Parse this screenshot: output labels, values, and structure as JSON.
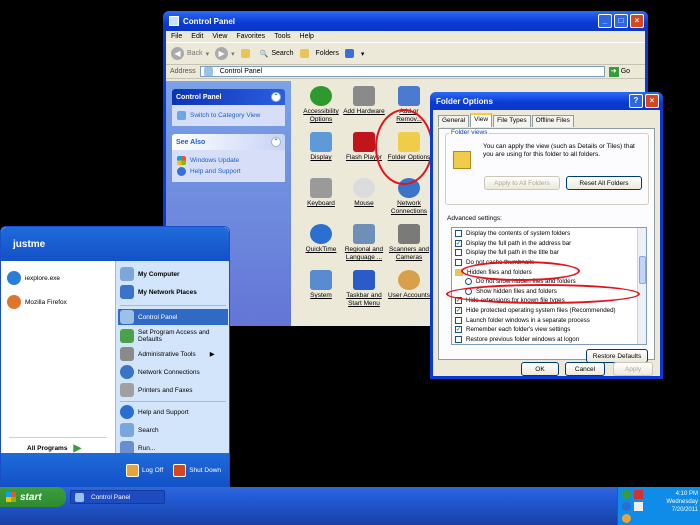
{
  "control_panel": {
    "title": "Control Panel",
    "menu": [
      "File",
      "Edit",
      "View",
      "Favorites",
      "Tools",
      "Help"
    ],
    "toolbar": {
      "back": "Back",
      "search": "Search",
      "folders": "Folders"
    },
    "address_label": "Address",
    "address_value": "Control Panel",
    "go": "Go",
    "left_pane": {
      "control_panel_header": "Control Panel",
      "switch_view": "Switch to Category View",
      "see_also_header": "See Also",
      "windows_update": "Windows Update",
      "help_support": "Help and Support"
    },
    "items": [
      {
        "label": "Accessibility Options"
      },
      {
        "label": "Add Hardware"
      },
      {
        "label": "Add or Remov..."
      },
      {
        "label": "Display"
      },
      {
        "label": "Flash Player"
      },
      {
        "label": "Folder Options"
      },
      {
        "label": "Keyboard"
      },
      {
        "label": "Mouse"
      },
      {
        "label": "Network Connections"
      },
      {
        "label": "QuickTime"
      },
      {
        "label": "Regional and Language ..."
      },
      {
        "label": "Scanners and Cameras"
      },
      {
        "label": "System"
      },
      {
        "label": "Taskbar and Start Menu"
      },
      {
        "label": "User Accounts"
      }
    ]
  },
  "folder_options": {
    "title": "Folder Options",
    "tabs": [
      "General",
      "View",
      "File Types",
      "Offline Files"
    ],
    "active_tab": "View",
    "folder_views_label": "Folder views",
    "folder_views_text": "You can apply the view (such as Details or Tiles) that you are using for this folder to all folders.",
    "apply_all": "Apply to All Folders",
    "reset_all": "Reset All Folders",
    "advanced_label": "Advanced settings:",
    "settings": [
      {
        "type": "check",
        "checked": false,
        "label": "Display the contents of system folders"
      },
      {
        "type": "check",
        "checked": true,
        "label": "Display the full path in the address bar"
      },
      {
        "type": "check",
        "checked": false,
        "label": "Display the full path in the title bar"
      },
      {
        "type": "check",
        "checked": false,
        "label": "Do not cache thumbnails"
      },
      {
        "type": "folder",
        "label": "Hidden files and folders"
      },
      {
        "type": "radio",
        "label": "Do not show hidden files and folders"
      },
      {
        "type": "radio",
        "label": "Show hidden files and folders"
      },
      {
        "type": "check",
        "checked": true,
        "label": "Hide extensions for known file types"
      },
      {
        "type": "check",
        "checked": true,
        "label": "Hide protected operating system files (Recommended)"
      },
      {
        "type": "check",
        "checked": false,
        "label": "Launch folder windows in a separate process"
      },
      {
        "type": "check",
        "checked": true,
        "label": "Remember each folder's view settings"
      },
      {
        "type": "check",
        "checked": false,
        "label": "Restore previous folder windows at logon"
      }
    ],
    "restore_defaults": "Restore Defaults",
    "ok": "OK",
    "cancel": "Cancel",
    "apply": "Apply"
  },
  "start_menu": {
    "user": "justme",
    "left_items": [
      {
        "label": "iexplore.exe"
      },
      {
        "label": "Mozilla Firefox"
      }
    ],
    "right_items": [
      {
        "label": "My Computer"
      },
      {
        "label": "My Network Places"
      },
      {
        "label": "Control Panel"
      },
      {
        "label": "Set Program Access and Defaults"
      },
      {
        "label": "Administrative Tools"
      },
      {
        "label": "Network Connections"
      },
      {
        "label": "Printers and Faxes"
      },
      {
        "label": "Help and Support"
      },
      {
        "label": "Search"
      },
      {
        "label": "Run..."
      }
    ],
    "all_programs": "All Programs",
    "log_off": "Log Off",
    "shut_down": "Shut Down"
  },
  "taskbar": {
    "start": "start",
    "task": "Control Panel",
    "time": "4:10 PM",
    "day": "Wednesday",
    "date": "7/20/2011"
  }
}
